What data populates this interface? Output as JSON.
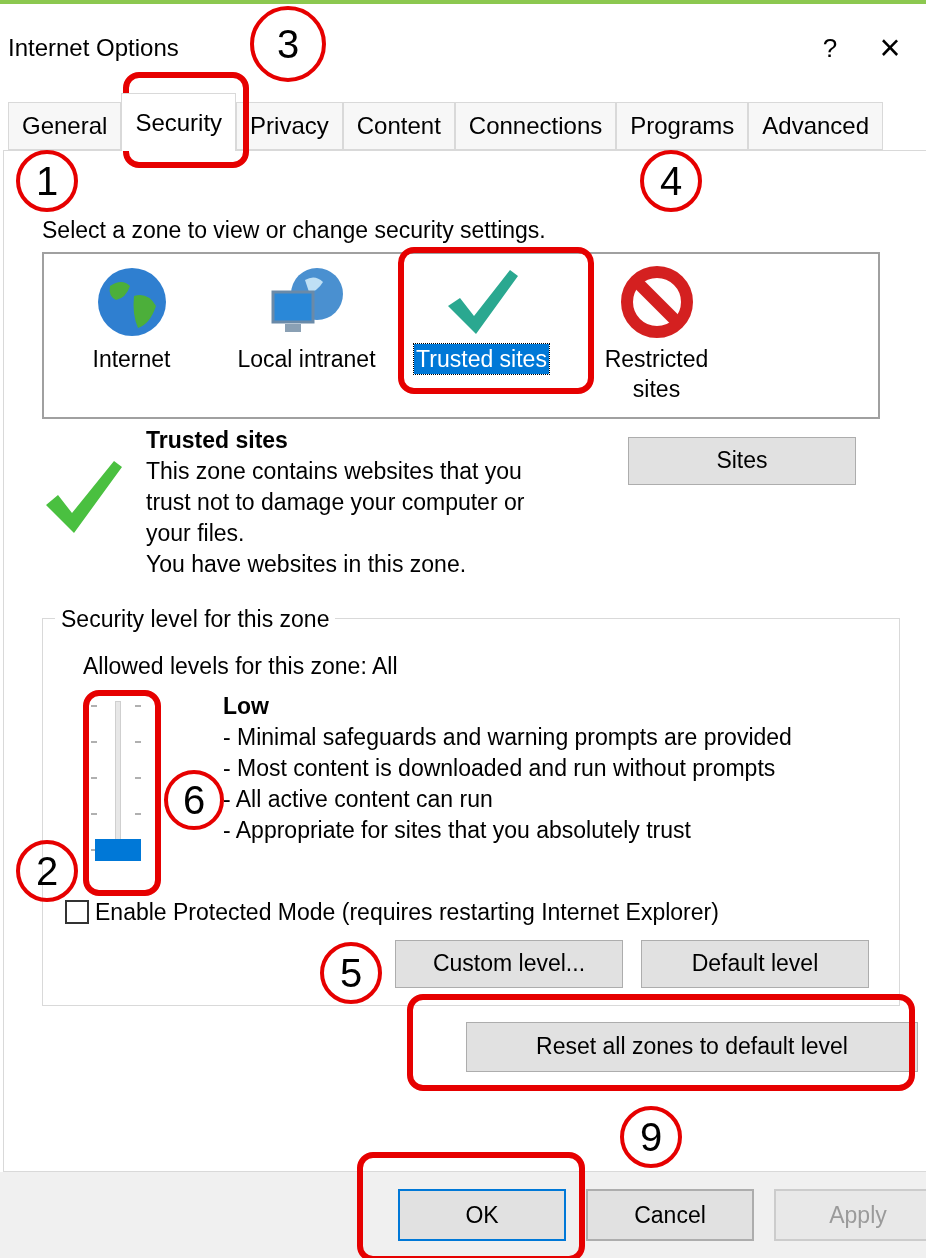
{
  "window": {
    "title": "Internet Options",
    "help": "?",
    "close": "×"
  },
  "tabs": [
    {
      "label": "General",
      "selected": false
    },
    {
      "label": "Security",
      "selected": true
    },
    {
      "label": "Privacy",
      "selected": false
    },
    {
      "label": "Content",
      "selected": false
    },
    {
      "label": "Connections",
      "selected": false
    },
    {
      "label": "Programs",
      "selected": false
    },
    {
      "label": "Advanced",
      "selected": false
    }
  ],
  "zone_prompt": "Select a zone to view or change security settings.",
  "zones": [
    {
      "label": "Internet",
      "kind": "globe",
      "selected": false
    },
    {
      "label": "Local intranet",
      "kind": "intranet",
      "selected": false
    },
    {
      "label": "Trusted sites",
      "kind": "check",
      "selected": true
    },
    {
      "label": "Restricted sites",
      "kind": "restricted",
      "selected": false
    }
  ],
  "zone_info": {
    "title": "Trusted sites",
    "description": "This zone contains websites that you trust not to damage your computer or your files.",
    "note": "You have websites in this zone.",
    "sites_button": "Sites"
  },
  "security_level": {
    "legend": "Security level for this zone",
    "allowed": "Allowed levels for this zone: All",
    "level": 0,
    "name": "Low",
    "bullets": [
      "- Minimal safeguards and warning prompts are provided",
      "- Most content is downloaded and run without prompts",
      "- All active content can run",
      "- Appropriate for sites that you absolutely trust"
    ],
    "protected_mode": {
      "label": "Enable Protected Mode (requires restarting Internet Explorer)",
      "checked": false
    },
    "buttons": [
      "Custom level...",
      "Default level"
    ]
  },
  "reset_button": "Reset all zones to default level",
  "footer": [
    {
      "label": "OK",
      "disabled": false,
      "default": true
    },
    {
      "label": "Cancel",
      "disabled": false,
      "default": false
    },
    {
      "label": "Apply",
      "disabled": true,
      "default": false
    }
  ],
  "annotations": [
    {
      "kind": "circle",
      "number": "3"
    },
    {
      "kind": "circle",
      "number": "4"
    },
    {
      "kind": "circle",
      "number": "1"
    },
    {
      "kind": "circle",
      "number": "2"
    },
    {
      "kind": "circle",
      "number": "6"
    },
    {
      "kind": "circle",
      "number": "5"
    },
    {
      "kind": "circle",
      "number": "9"
    },
    {
      "kind": "box"
    },
    {
      "kind": "box"
    },
    {
      "kind": "box"
    },
    {
      "kind": "box"
    },
    {
      "kind": "box"
    }
  ]
}
